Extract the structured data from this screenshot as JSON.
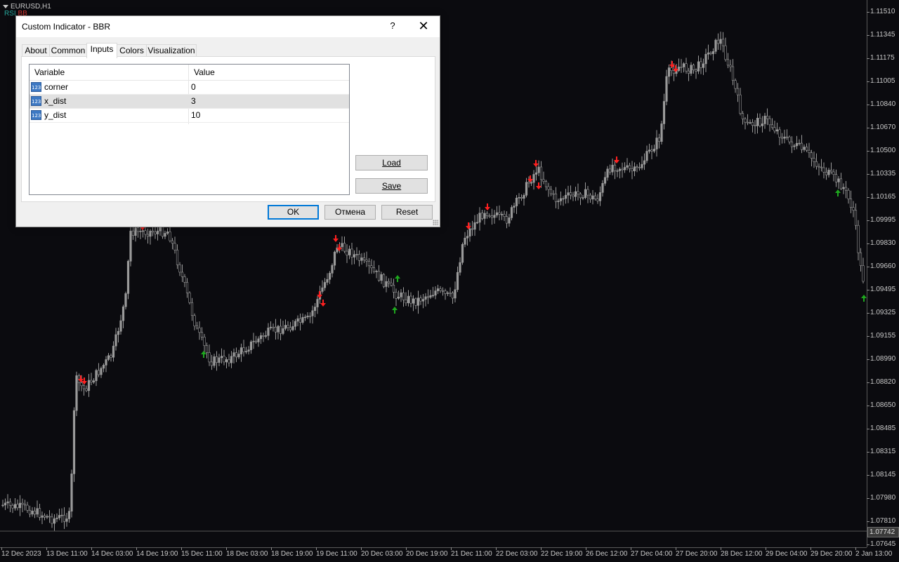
{
  "chart": {
    "symbol_label": "EURUSD,H1",
    "indicator_labels": [
      {
        "text": "RSI",
        "color": "#26a69a"
      },
      {
        "text": "BB",
        "color": "#e53935"
      }
    ],
    "current_price": "1.07742",
    "colors": {
      "background": "#0b0b0f",
      "candle": "#9a9a9a",
      "sell_arrow": "#ff2020",
      "buy_arrow": "#1ea81e"
    },
    "price_axis": [
      "1.11510",
      "1.11345",
      "1.11175",
      "1.11005",
      "1.10840",
      "1.10670",
      "1.10500",
      "1.10335",
      "1.10165",
      "1.09995",
      "1.09830",
      "1.09660",
      "1.09495",
      "1.09325",
      "1.09155",
      "1.08990",
      "1.08820",
      "1.08650",
      "1.08485",
      "1.08315",
      "1.08145",
      "1.07980",
      "1.07810",
      "1.07645"
    ],
    "time_axis": [
      "12 Dec 2023",
      "13 Dec 11:00",
      "14 Dec 03:00",
      "14 Dec 19:00",
      "15 Dec 11:00",
      "18 Dec 03:00",
      "18 Dec 19:00",
      "19 Dec 11:00",
      "20 Dec 03:00",
      "20 Dec 19:00",
      "21 Dec 11:00",
      "22 Dec 03:00",
      "22 Dec 19:00",
      "26 Dec 12:00",
      "27 Dec 04:00",
      "27 Dec 20:00",
      "28 Dec 12:00",
      "29 Dec 04:00",
      "29 Dec 20:00",
      "2 Jan 13:00"
    ]
  },
  "dialog": {
    "title": "Custom Indicator - BBR",
    "help_label": "?",
    "close_label": "✕",
    "tabs": [
      "About",
      "Common",
      "Inputs",
      "Colors",
      "Visualization"
    ],
    "active_tab": "Inputs",
    "table": {
      "headers": [
        "Variable",
        "Value"
      ],
      "rows": [
        {
          "name": "corner",
          "value": "0",
          "icon": "123"
        },
        {
          "name": "x_dist",
          "value": "3",
          "icon": "123"
        },
        {
          "name": "y_dist",
          "value": "10",
          "icon": "123"
        }
      ]
    },
    "side_buttons": {
      "load": "Load",
      "save": "Save"
    },
    "footer_buttons": {
      "ok": "OK",
      "cancel": "Отмена",
      "reset": "Reset"
    }
  }
}
